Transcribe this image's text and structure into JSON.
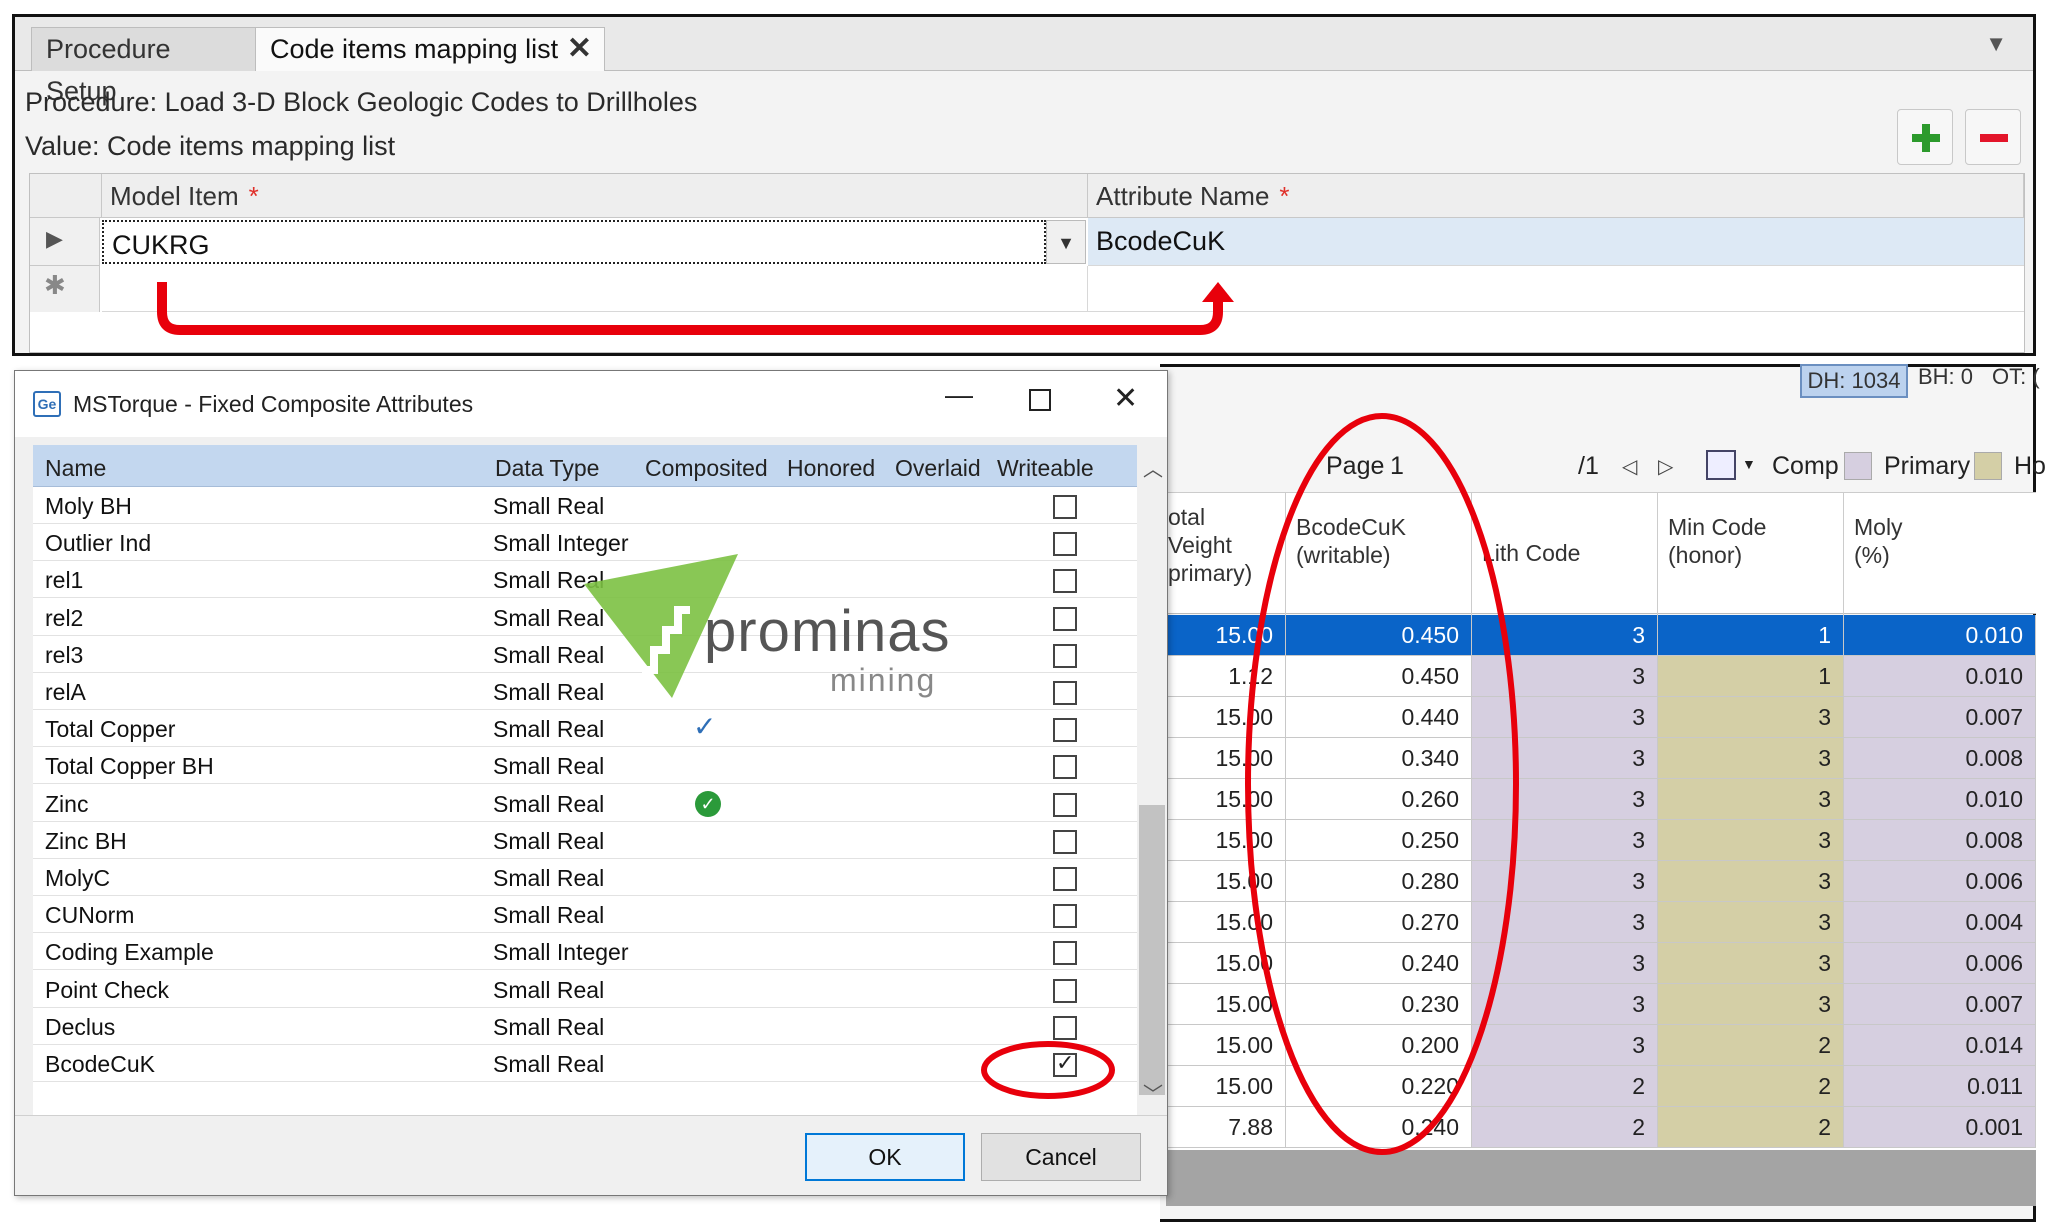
{
  "top_panel": {
    "tabs": [
      {
        "label": "Procedure Setup"
      },
      {
        "label": "Code items mapping list",
        "close": "✕"
      }
    ],
    "procedure_line": "Procedure: Load 3-D Block Geologic Codes to Drillholes",
    "value_line": "Value: Code items mapping list",
    "grid": {
      "columns": [
        "Model Item",
        "Attribute Name"
      ],
      "required_marker": "*",
      "row": {
        "model_item": "CUKRG",
        "attribute_name": "BcodeCuK"
      },
      "new_row_marker": "✱"
    }
  },
  "status_bar": {
    "dh": "DH: 1034",
    "bh": "BH: 0",
    "ot": "OT: ("
  },
  "data_grid": {
    "toolbar": {
      "page_label": "Page",
      "page": "1",
      "page_total": "/1",
      "comp": "Comp",
      "primary": "Primary",
      "more": "Ho"
    },
    "columns": [
      "otal\nVeight\nprimary)",
      "BcodeCuK\n(writable)",
      "Lith Code",
      "Min Code\n(honor)",
      "Moly\n(%)"
    ],
    "rows": [
      [
        "15.00",
        "0.450",
        "3",
        "1",
        "0.010"
      ],
      [
        "1.12",
        "0.450",
        "3",
        "1",
        "0.010"
      ],
      [
        "15.00",
        "0.440",
        "3",
        "3",
        "0.007"
      ],
      [
        "15.00",
        "0.340",
        "3",
        "3",
        "0.008"
      ],
      [
        "15.00",
        "0.260",
        "3",
        "3",
        "0.010"
      ],
      [
        "15.00",
        "0.250",
        "3",
        "3",
        "0.008"
      ],
      [
        "15.00",
        "0.280",
        "3",
        "3",
        "0.006"
      ],
      [
        "15.00",
        "0.270",
        "3",
        "3",
        "0.004"
      ],
      [
        "15.00",
        "0.240",
        "3",
        "3",
        "0.006"
      ],
      [
        "15.00",
        "0.230",
        "3",
        "3",
        "0.007"
      ],
      [
        "15.00",
        "0.200",
        "3",
        "2",
        "0.014"
      ],
      [
        "15.00",
        "0.220",
        "2",
        "2",
        "0.011"
      ],
      [
        "7.88",
        "0.240",
        "2",
        "2",
        "0.001"
      ]
    ],
    "selected_row": 0,
    "colors": {
      "comp": "#d6cfe0",
      "primary": "#d4cfa6",
      "selected": "#0a64c8"
    }
  },
  "dialog": {
    "app_icon": "Ge",
    "title": "MSTorque - Fixed Composite Attributes",
    "window_controls": {
      "minimize": "—",
      "close": "✕"
    },
    "columns": [
      "Name",
      "Data Type",
      "Composited",
      "Honored",
      "Overlaid",
      "Writeable"
    ],
    "rows": [
      {
        "name": "Moly BH",
        "type": "Small Real",
        "composited": "",
        "writeable": false
      },
      {
        "name": "Outlier Ind",
        "type": "Small Integer",
        "composited": "",
        "writeable": false
      },
      {
        "name": "rel1",
        "type": "Small Real",
        "composited": "",
        "writeable": false
      },
      {
        "name": "rel2",
        "type": "Small Real",
        "composited": "",
        "writeable": false
      },
      {
        "name": "rel3",
        "type": "Small Real",
        "composited": "",
        "writeable": false
      },
      {
        "name": "relA",
        "type": "Small Real",
        "composited": "",
        "writeable": false
      },
      {
        "name": "Total Copper",
        "type": "Small Real",
        "composited": "check",
        "writeable": false
      },
      {
        "name": "Total Copper BH",
        "type": "Small Real",
        "composited": "",
        "writeable": false
      },
      {
        "name": "Zinc",
        "type": "Small Real",
        "composited": "badge",
        "writeable": false
      },
      {
        "name": "Zinc BH",
        "type": "Small Real",
        "composited": "",
        "writeable": false
      },
      {
        "name": "MolyC",
        "type": "Small Real",
        "composited": "",
        "writeable": false
      },
      {
        "name": "CUNorm",
        "type": "Small Real",
        "composited": "",
        "writeable": false
      },
      {
        "name": "Coding Example",
        "type": "Small Integer",
        "composited": "",
        "writeable": false
      },
      {
        "name": "Point Check",
        "type": "Small Real",
        "composited": "",
        "writeable": false
      },
      {
        "name": "Declus",
        "type": "Small Real",
        "composited": "",
        "writeable": false
      },
      {
        "name": "BcodeCuK",
        "type": "Small Real",
        "composited": "",
        "writeable": true
      }
    ],
    "ok_label": "OK",
    "cancel_label": "Cancel"
  },
  "logo": {
    "name": "prominas",
    "sub": "mining",
    "color": "#7cc142"
  },
  "annotation_color": "#e8000b"
}
